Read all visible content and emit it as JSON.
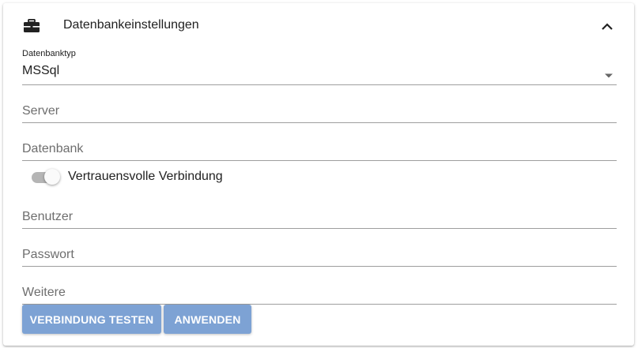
{
  "panel": {
    "title": "Datenbankeinstellungen",
    "header_icon": "briefcase-icon",
    "collapse_icon": "chevron-up-icon"
  },
  "fields": {
    "db_type": {
      "label": "Datenbanktyp",
      "value": "MSSql",
      "icon": "dropdown-arrow-icon"
    },
    "server": {
      "placeholder": "Server",
      "value": ""
    },
    "database": {
      "placeholder": "Datenbank",
      "value": ""
    },
    "trusted": {
      "label": "Vertrauensvolle Verbindung",
      "checked": true
    },
    "user": {
      "placeholder": "Benutzer",
      "value": ""
    },
    "password": {
      "placeholder": "Passwort",
      "value": ""
    },
    "more": {
      "placeholder": "Weitere",
      "value": ""
    }
  },
  "buttons": {
    "test": "VERBINDUNG TESTEN",
    "apply": "ANWENDEN"
  },
  "colors": {
    "button_bg": "#7da2d4",
    "underline": "#9e9e9e",
    "toggle_track": "#b5b5b5"
  }
}
